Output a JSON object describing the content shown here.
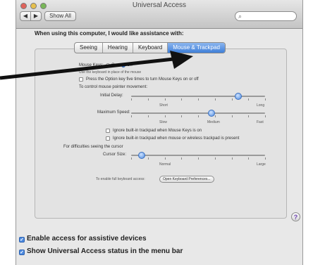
{
  "window": {
    "title": "Universal Access"
  },
  "toolbar": {
    "back_glyph": "◀",
    "forward_glyph": "▶",
    "show_all_label": "Show All",
    "search_placeholder": "",
    "search_icon": "search-icon"
  },
  "heading": "When using this computer, I would like assistance with:",
  "tabs": [
    {
      "label": "Seeing"
    },
    {
      "label": "Hearing"
    },
    {
      "label": "Keyboard"
    },
    {
      "label": "Mouse & Trackpad",
      "selected": true
    }
  ],
  "mouse_keys": {
    "label": "Mouse Keys:",
    "on_label": "On",
    "off_label": "Off",
    "selected": "off",
    "hint": "Use the keyboard in place of the mouse",
    "option_toggle_label": "Press the Option key five times to turn Mouse Keys on or off"
  },
  "pointer": {
    "heading": "To control mouse pointer movement:",
    "initial_delay": {
      "label": "Initial Delay:",
      "min_label": "Short",
      "max_label": "Long",
      "value": 0.8
    },
    "maximum_speed": {
      "label": "Maximum Speed:",
      "min_label": "Slow",
      "mid_label": "Medium",
      "max_label": "Fast",
      "value": 0.6
    }
  },
  "ignore_trackpad_mouse_keys": "Ignore built-in trackpad when Mouse Keys is on",
  "ignore_trackpad_mouse_present": "Ignore built-in trackpad when mouse or wireless trackpad is present",
  "cursor": {
    "heading": "For difficulties seeing the cursor",
    "label": "Cursor Size:",
    "min_label": "Normal",
    "max_label": "Large",
    "value": 0.08
  },
  "keyboard_prefs": {
    "hint": "To enable full keyboard access:",
    "button_label": "Open Keyboard Preferences..."
  },
  "help_glyph": "?",
  "bottom": {
    "enable_access": "Enable access for assistive devices",
    "show_status": "Show Universal Access status in the menu bar",
    "check_glyph": "✓"
  },
  "colors": {
    "accent": "#3f7fd9",
    "arrow": "#111111"
  }
}
